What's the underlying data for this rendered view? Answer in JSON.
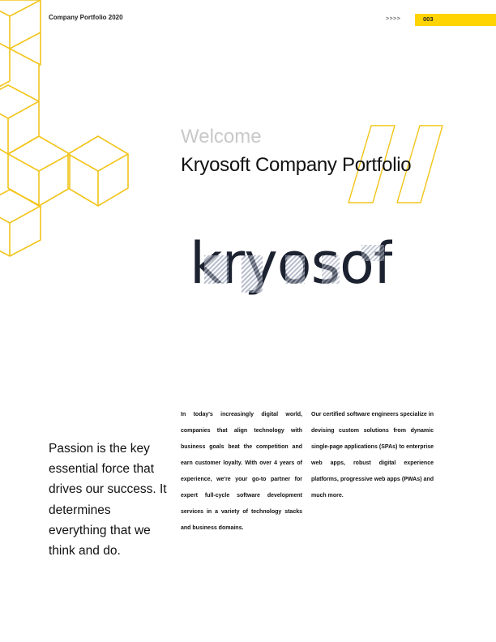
{
  "header": {
    "title": "Company Portfolio 2020",
    "arrows": ">>>>",
    "page_number": "003"
  },
  "colors": {
    "accent": "#FFD400",
    "line": "#F2C51C",
    "text": "#111111",
    "muted": "#C9C9C9"
  },
  "hero": {
    "welcome": "Welcome",
    "title": "Kryosoft Company Portfolio"
  },
  "logo": {
    "text": "kryosoft"
  },
  "passion": {
    "text": "Passion is the key essential force that drives our success. It determines everything that we think and do."
  },
  "body": {
    "col_left": "In today's increasingly digital world, companies that align technology with business goals beat the competition and earn customer loyalty. With over 4 years of experience, we're your go-to partner for expert full-cycle software development services in a variety of technology stacks and business domains.",
    "col_right": "Our certified software engineers specialize in devising custom solutions from dynamic single-page applications (SPAs) to enterprise web apps, robust digital experience platforms, progressive web apps (PWAs) and much more."
  }
}
